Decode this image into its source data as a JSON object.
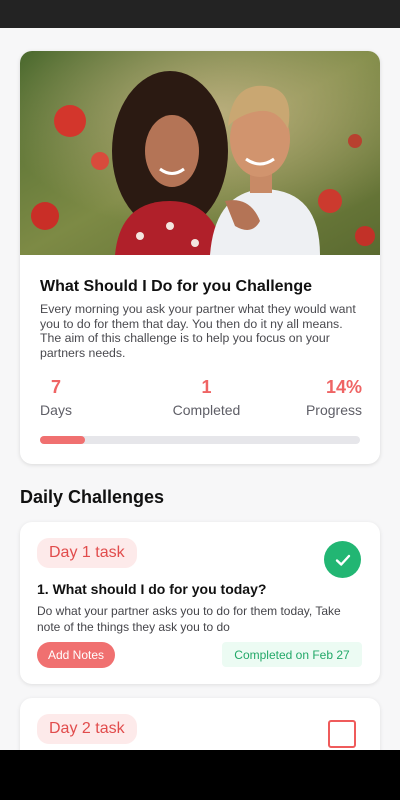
{
  "challenge": {
    "title": "What Should I Do for you Challenge",
    "description": "Every morning you ask your partner what they would want you to do for them that day. You then do it ny all means. The aim of this challenge is to help you focus on your partners needs.",
    "stats": {
      "days": {
        "value": "7",
        "label": "Days"
      },
      "completed": {
        "value": "1",
        "label": "Completed"
      },
      "progress": {
        "value": "14%",
        "label": "Progress",
        "fraction": 0.14
      }
    }
  },
  "daily": {
    "title": "Daily Challenges",
    "tasks": [
      {
        "badge": "Day 1 task",
        "title": "1. What should I do for you today?",
        "description": "Do what your partner asks you to do for them today, Take note of the things they ask you to do",
        "add_notes_label": "Add Notes",
        "status": "Completed on Feb 27",
        "done": true
      },
      {
        "badge": "Day 2 task",
        "done": false
      }
    ]
  },
  "colors": {
    "accent": "#ef6464",
    "success": "#22b673",
    "track": "#e6e6ea"
  }
}
